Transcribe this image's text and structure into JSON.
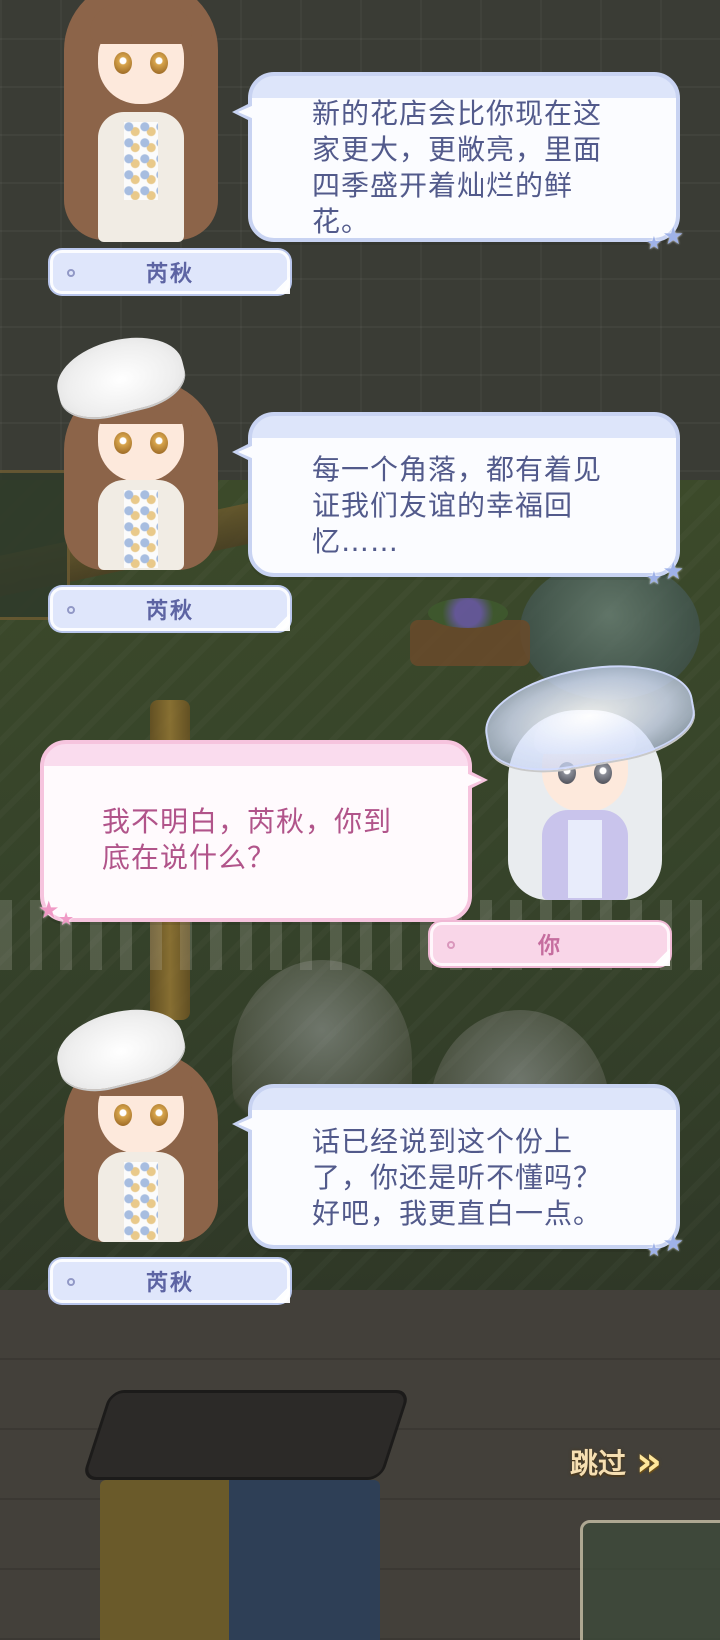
{
  "dialogue": [
    {
      "speaker": "芮秋",
      "side": "npc",
      "text": "新的花店会比你现在这\n家更大，更敞亮，里面\n四季盛开着灿烂的鲜\n花。"
    },
    {
      "speaker": "芮秋",
      "side": "npc",
      "text": "每一个角落，都有着见\n证我们友谊的幸福回\n忆……"
    },
    {
      "speaker": "你",
      "side": "player",
      "text": "我不明白，芮秋，你到\n底在说什么？"
    },
    {
      "speaker": "芮秋",
      "side": "npc",
      "text": "话已经说到这个份上\n了，你还是听不懂吗？\n好吧，我更直白一点。"
    }
  ],
  "controls": {
    "skip_label": "跳过",
    "skip_icon": "double-chevron-right-icon"
  },
  "colors": {
    "npc_bubble_border": "#c8d3f2",
    "npc_text": "#525a8b",
    "player_bubble_border": "#f6c4de",
    "player_text": "#b1548a",
    "skip_text": "#f6dfb2"
  }
}
